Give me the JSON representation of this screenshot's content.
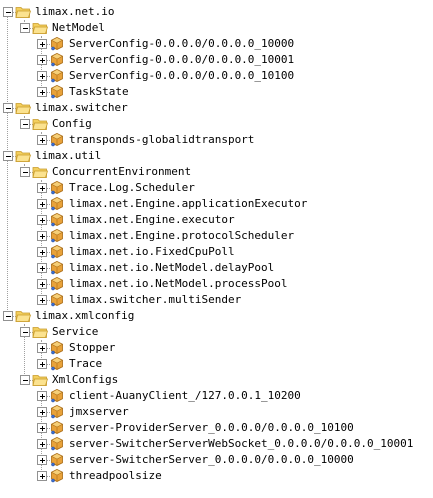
{
  "tree": {
    "nodes": [
      {
        "label": "limax.net.io",
        "depth": 0,
        "kind": "folder",
        "expanded": true
      },
      {
        "label": "NetModel",
        "depth": 1,
        "kind": "folder",
        "expanded": true
      },
      {
        "label": "ServerConfig-0.0.0.0/0.0.0.0_10000",
        "depth": 2,
        "kind": "mbean",
        "expanded": false
      },
      {
        "label": "ServerConfig-0.0.0.0/0.0.0.0_10001",
        "depth": 2,
        "kind": "mbean",
        "expanded": false
      },
      {
        "label": "ServerConfig-0.0.0.0/0.0.0.0_10100",
        "depth": 2,
        "kind": "mbean",
        "expanded": false
      },
      {
        "label": "TaskState",
        "depth": 2,
        "kind": "mbean",
        "expanded": false
      },
      {
        "label": "limax.switcher",
        "depth": 0,
        "kind": "folder",
        "expanded": true
      },
      {
        "label": "Config",
        "depth": 1,
        "kind": "folder",
        "expanded": true
      },
      {
        "label": "transponds-globalidtransport",
        "depth": 2,
        "kind": "mbean",
        "expanded": false
      },
      {
        "label": "limax.util",
        "depth": 0,
        "kind": "folder",
        "expanded": true
      },
      {
        "label": "ConcurrentEnvironment",
        "depth": 1,
        "kind": "folder",
        "expanded": true
      },
      {
        "label": "Trace.Log.Scheduler",
        "depth": 2,
        "kind": "mbean",
        "expanded": false
      },
      {
        "label": "limax.net.Engine.applicationExecutor",
        "depth": 2,
        "kind": "mbean",
        "expanded": false
      },
      {
        "label": "limax.net.Engine.executor",
        "depth": 2,
        "kind": "mbean",
        "expanded": false
      },
      {
        "label": "limax.net.Engine.protocolScheduler",
        "depth": 2,
        "kind": "mbean",
        "expanded": false
      },
      {
        "label": "limax.net.io.FixedCpuPoll",
        "depth": 2,
        "kind": "mbean",
        "expanded": false
      },
      {
        "label": "limax.net.io.NetModel.delayPool",
        "depth": 2,
        "kind": "mbean",
        "expanded": false
      },
      {
        "label": "limax.net.io.NetModel.processPool",
        "depth": 2,
        "kind": "mbean",
        "expanded": false
      },
      {
        "label": "limax.switcher.multiSender",
        "depth": 2,
        "kind": "mbean",
        "expanded": false
      },
      {
        "label": "limax.xmlconfig",
        "depth": 0,
        "kind": "folder",
        "expanded": true
      },
      {
        "label": "Service",
        "depth": 1,
        "kind": "folder",
        "expanded": true
      },
      {
        "label": "Stopper",
        "depth": 2,
        "kind": "mbean",
        "expanded": false
      },
      {
        "label": "Trace",
        "depth": 2,
        "kind": "mbean",
        "expanded": false
      },
      {
        "label": "XmlConfigs",
        "depth": 1,
        "kind": "folder",
        "expanded": true
      },
      {
        "label": "client-AuanyClient_/127.0.0.1_10200",
        "depth": 2,
        "kind": "mbean",
        "expanded": false
      },
      {
        "label": "jmxserver",
        "depth": 2,
        "kind": "mbean",
        "expanded": false
      },
      {
        "label": "server-ProviderServer_0.0.0.0/0.0.0.0_10100",
        "depth": 2,
        "kind": "mbean",
        "expanded": false
      },
      {
        "label": "server-SwitcherServerWebSocket_0.0.0.0/0.0.0.0_10001",
        "depth": 2,
        "kind": "mbean",
        "expanded": false
      },
      {
        "label": "server-SwitcherServer_0.0.0.0/0.0.0.0_10000",
        "depth": 2,
        "kind": "mbean",
        "expanded": false
      },
      {
        "label": "threadpoolsize",
        "depth": 2,
        "kind": "mbean",
        "expanded": false
      }
    ]
  },
  "colors": {
    "folder_body": "#f3cf5e",
    "folder_front": "#fbe28f",
    "folder_edge": "#c89b2a",
    "bean_main": "#e8a23a",
    "bean_light": "#f6cf78",
    "bean_dark": "#a86a14",
    "bean_accent": "#3b6fd1"
  }
}
